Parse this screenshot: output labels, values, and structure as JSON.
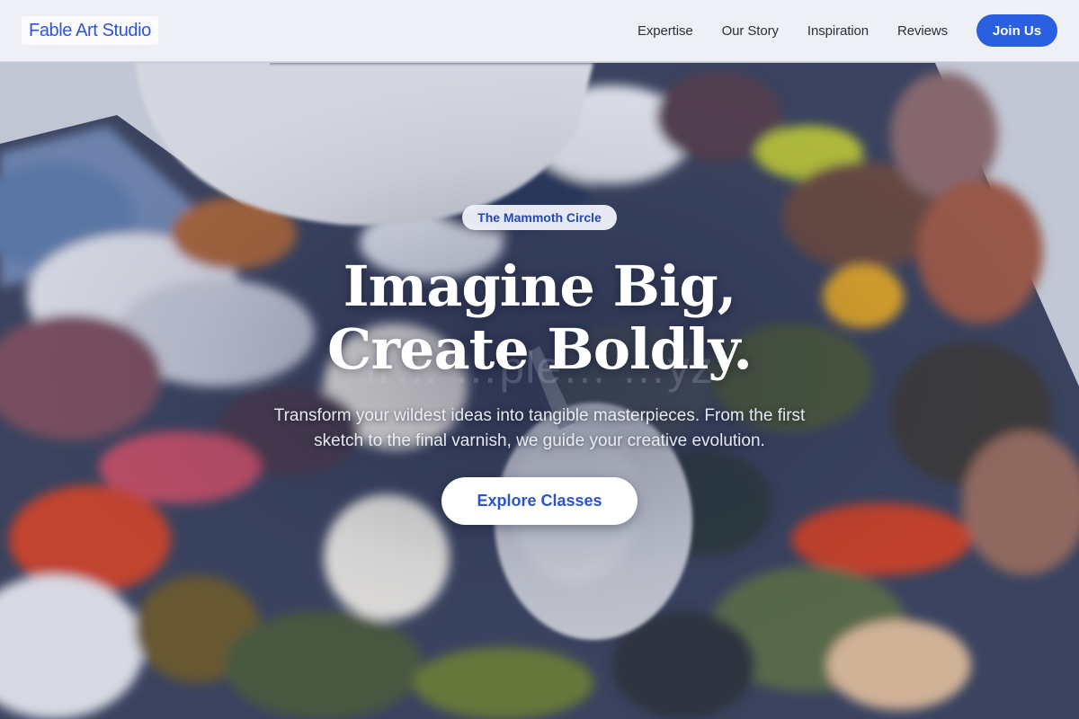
{
  "nav": {
    "logo": "Fable Art Studio",
    "links": [
      "Expertise",
      "Our Story",
      "Inspiration",
      "Reviews"
    ],
    "cta_label": "Join Us"
  },
  "hero": {
    "badge": "The Mammoth Circle",
    "headline_line1": "Imagine Big,",
    "headline_line2": "Create Boldly.",
    "subtitle_line1": "Transform your wildest ideas into tangible masterpieces. From the first",
    "subtitle_line2": "sketch to the final varnish, we guide your creative evolution.",
    "cta_label": "Explore Classes",
    "watermark": "fr… …ple… …yz"
  },
  "colors": {
    "accent": "#2a5fe0",
    "logo_text": "#2b56d8",
    "badge_text": "#2348b5"
  }
}
